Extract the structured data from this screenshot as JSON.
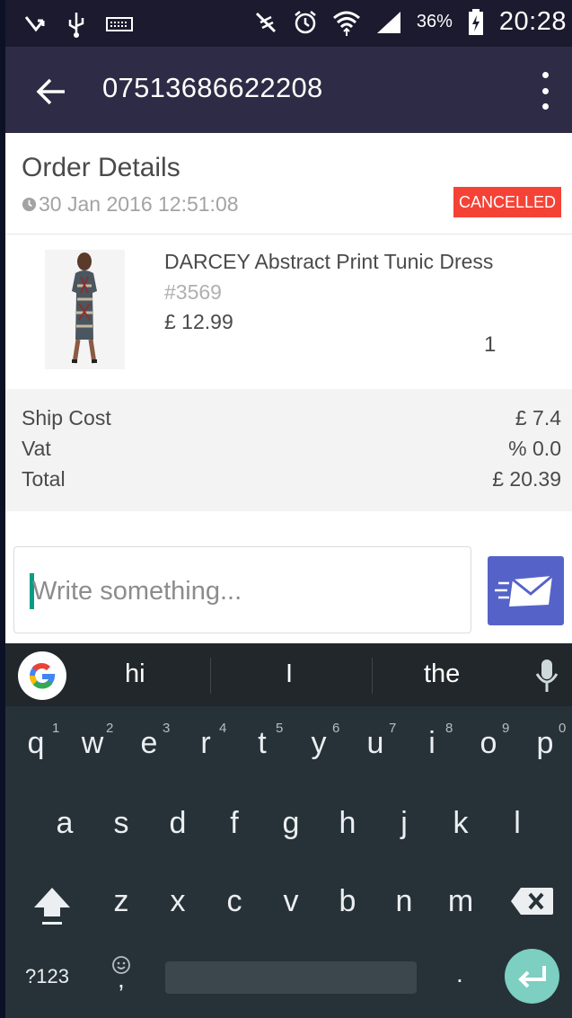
{
  "status_bar": {
    "battery_percent": "36%",
    "time": "20:28",
    "icons": [
      "missed-call-icon",
      "usb-icon",
      "keyboard-icon",
      "vibrate-off-icon",
      "alarm-icon",
      "wifi-icon",
      "signal-icon",
      "battery-charging-icon"
    ]
  },
  "app_bar": {
    "title": "07513686622208",
    "back_icon": "arrow-back-icon",
    "menu_icon": "more-vert-icon"
  },
  "order": {
    "heading": "Order Details",
    "date": "30 Jan 2016 12:51:08",
    "status": "CANCELLED",
    "status_color": "#f44336"
  },
  "item": {
    "name": "DARCEY Abstract Print Tunic Dress",
    "sku": "#3569",
    "price": "£ 12.99",
    "quantity": "1"
  },
  "summary": {
    "rows": [
      {
        "label": "Ship Cost",
        "value": "£ 7.4"
      },
      {
        "label": "Vat",
        "value": "% 0.0"
      },
      {
        "label": "Total",
        "value": "£ 20.39"
      }
    ]
  },
  "compose": {
    "placeholder": "Write something...",
    "send_icon": "send-mail-icon",
    "accent": "#5563c8"
  },
  "keyboard": {
    "suggestions": [
      "hi",
      "I",
      "the"
    ],
    "row1": [
      "q",
      "w",
      "e",
      "r",
      "t",
      "y",
      "u",
      "i",
      "o",
      "p"
    ],
    "row1_hints": [
      "1",
      "2",
      "3",
      "4",
      "5",
      "6",
      "7",
      "8",
      "9",
      "0"
    ],
    "row2": [
      "a",
      "s",
      "d",
      "f",
      "g",
      "h",
      "j",
      "k",
      "l"
    ],
    "row3": [
      "z",
      "x",
      "c",
      "v",
      "b",
      "n",
      "m"
    ],
    "symbols_label": "?123",
    "comma": ",",
    "period": "."
  }
}
